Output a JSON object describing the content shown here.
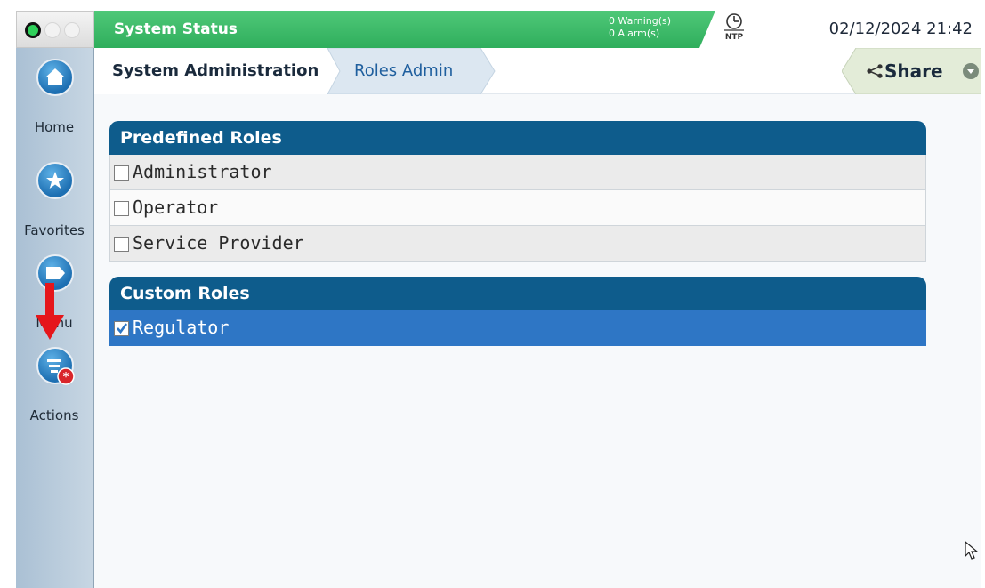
{
  "status_lights": [
    "green-light",
    "off-light",
    "off-light"
  ],
  "status_bar": {
    "title": "System Status",
    "warnings": "0 Warning(s)",
    "alarms": "0 Alarm(s)",
    "ntp_label": "NTP",
    "datetime": "02/12/2024 21:42",
    "color": "#3bb866"
  },
  "breadcrumb": {
    "items": [
      "System Administration",
      "Roles Admin"
    ],
    "share_label": "Share"
  },
  "leftnav": {
    "items": [
      {
        "label": "Home",
        "icon": "home-icon"
      },
      {
        "label": "Favorites",
        "icon": "star-icon"
      },
      {
        "label": "Menu",
        "icon": "menu-icon"
      },
      {
        "label": "Actions",
        "icon": "actions-icon"
      }
    ]
  },
  "sections": {
    "predefined": {
      "title": "Predefined Roles",
      "roles": [
        {
          "label": "Administrator",
          "checked": false
        },
        {
          "label": "Operator",
          "checked": false
        },
        {
          "label": "Service Provider",
          "checked": false
        }
      ]
    },
    "custom": {
      "title": "Custom Roles",
      "roles": [
        {
          "label": "Regulator",
          "checked": true
        }
      ]
    }
  },
  "colors": {
    "header_blue": "#0e5c8c",
    "selected_blue": "#2e76c5",
    "status_green": "#3bb866"
  }
}
